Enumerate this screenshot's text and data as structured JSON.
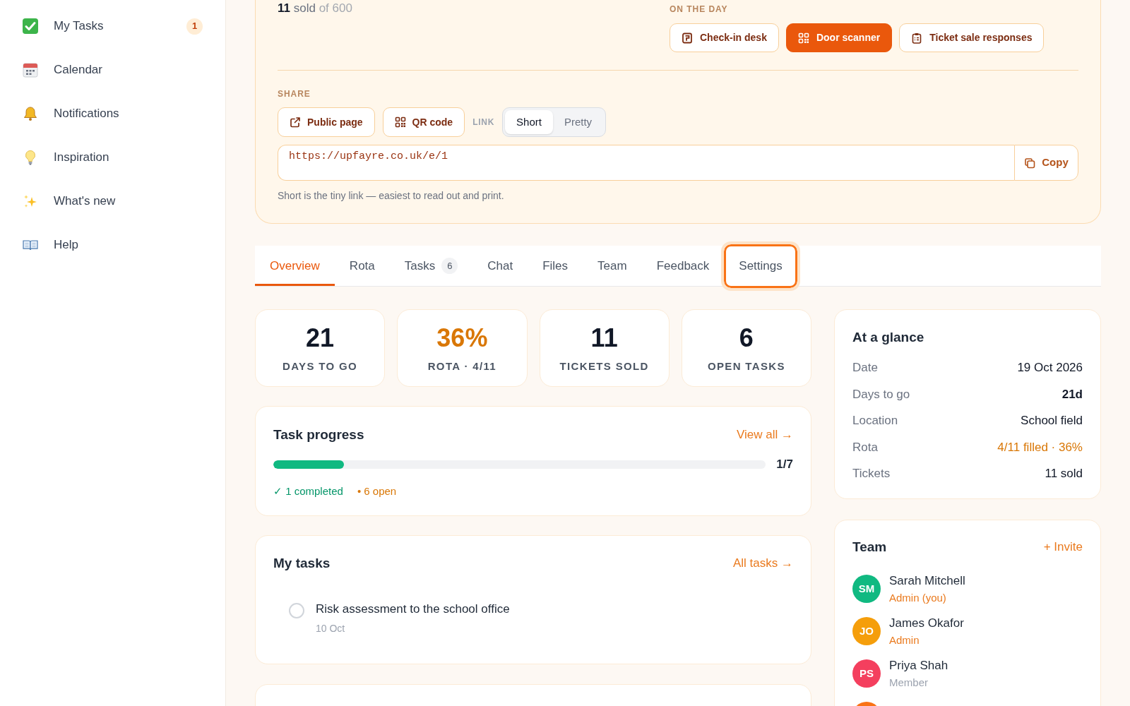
{
  "sidebar": {
    "items": [
      {
        "label": "My Tasks",
        "badge": "1"
      },
      {
        "label": "Calendar"
      },
      {
        "label": "Notifications"
      },
      {
        "label": "Inspiration"
      },
      {
        "label": "What's new"
      },
      {
        "label": "Help"
      }
    ]
  },
  "event_panel": {
    "tickets": {
      "sold": "11",
      "unit": "sold",
      "total": "of 600"
    },
    "on_the_day": {
      "label": "ON THE DAY",
      "buttons": [
        {
          "label": "Check-in desk",
          "primary": false
        },
        {
          "label": "Door scanner",
          "primary": true
        },
        {
          "label": "Ticket sale responses",
          "primary": false
        }
      ]
    },
    "share": {
      "label": "SHARE",
      "buttons": [
        {
          "label": "Public page"
        },
        {
          "label": "QR code"
        }
      ],
      "link_label": "LINK",
      "link_styles": [
        {
          "label": "Short",
          "selected": true
        },
        {
          "label": "Pretty",
          "selected": false
        }
      ],
      "url": "https://upfayre.co.uk/e/1",
      "copy_button": "Copy",
      "hint": "Short is the tiny link — easiest to read out and print."
    }
  },
  "tabs": [
    {
      "label": "Overview",
      "selected": true,
      "focused": false
    },
    {
      "label": "Rota",
      "selected": false,
      "focused": false
    },
    {
      "label": "Tasks",
      "count": "6",
      "selected": false,
      "focused": false
    },
    {
      "label": "Chat",
      "selected": false,
      "focused": false
    },
    {
      "label": "Files",
      "selected": false,
      "focused": false
    },
    {
      "label": "Team",
      "selected": false,
      "focused": false
    },
    {
      "label": "Feedback",
      "selected": false,
      "focused": false
    },
    {
      "label": "Settings",
      "selected": false,
      "focused": true
    }
  ],
  "stats": [
    {
      "value": "21",
      "label": "DAYS TO GO",
      "highlight": false
    },
    {
      "value": "36%",
      "label": "ROTA · 4/11",
      "highlight": true
    },
    {
      "value": "11",
      "label": "TICKETS SOLD",
      "highlight": false
    },
    {
      "value": "6",
      "label": "OPEN TASKS",
      "highlight": false
    }
  ],
  "task_progress": {
    "title": "Task progress",
    "link": "View all →",
    "level": 0.143,
    "reading": "1/7",
    "completed": "✓ 1 completed",
    "open": "• 6 open"
  },
  "my_tasks": {
    "title": "My tasks",
    "link": "All tasks →",
    "tasks": [
      {
        "title": "Risk assessment to the school office",
        "due": "10 Oct",
        "checked": false
      }
    ]
  },
  "at_a_glance": {
    "title": "At a glance",
    "rows": [
      {
        "label": "Date",
        "value": "19 Oct 2026",
        "kind": "date"
      },
      {
        "label": "Days to go",
        "value": "21d",
        "kind": "countdown"
      },
      {
        "label": "Location",
        "value": "School field",
        "kind": "place"
      },
      {
        "label": "Rota",
        "value": "4/11 filled · 36%",
        "kind": "progress"
      },
      {
        "label": "Tickets",
        "value": "11 sold",
        "kind": "count"
      }
    ]
  },
  "team": {
    "title": "Team",
    "invite": "+ Invite",
    "members": [
      {
        "initials": "SM",
        "name": "Sarah Mitchell",
        "role": "Admin (you)",
        "admin": true,
        "color": "#10b981"
      },
      {
        "initials": "JO",
        "name": "James Okafor",
        "role": "Admin",
        "admin": true,
        "color": "#f59e0b"
      },
      {
        "initials": "PS",
        "name": "Priya Shah",
        "role": "Member",
        "admin": false,
        "color": "#f43f5e"
      },
      {
        "color": "#f97316"
      }
    ]
  }
}
